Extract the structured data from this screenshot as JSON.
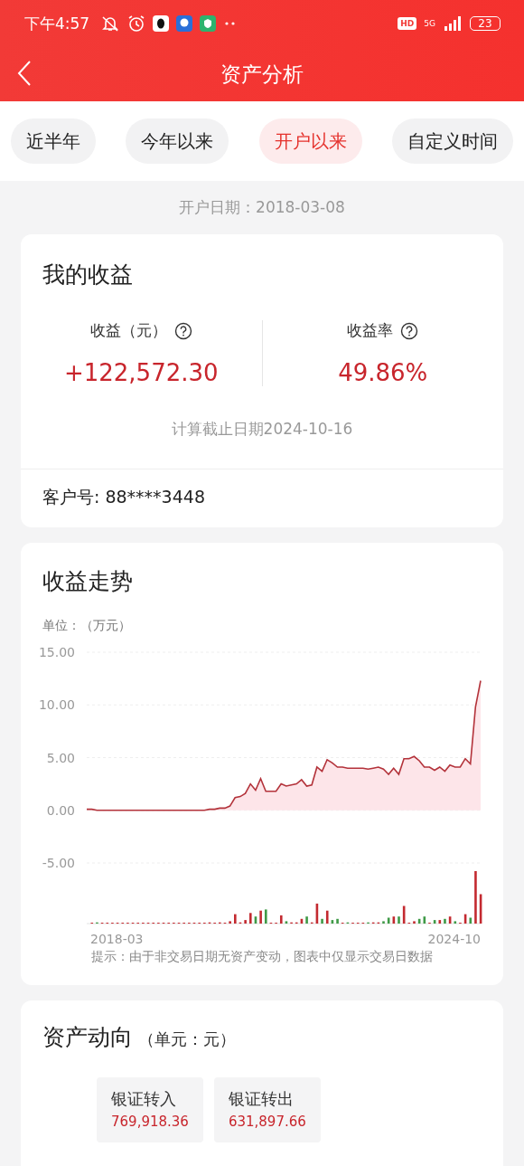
{
  "status_bar": {
    "time": "下午4:57",
    "hd": "HD",
    "network": "5G",
    "battery": "23"
  },
  "header": {
    "title": "资产分析"
  },
  "tabs": [
    {
      "label": "近半年",
      "selected": false
    },
    {
      "label": "今年以来",
      "selected": false
    },
    {
      "label": "开户以来",
      "selected": true
    },
    {
      "label": "自定义时间",
      "selected": false
    }
  ],
  "open_date": "开户日期：2018-03-08",
  "earnings": {
    "title": "我的收益",
    "metrics": [
      {
        "label": "收益（元）",
        "value": "+122,572.30"
      },
      {
        "label": "收益率",
        "value": "49.86%"
      }
    ],
    "as_of": "计算截止日期2024-10-16",
    "customer": "客户号: 88****3448"
  },
  "trend": {
    "title": "收益走势",
    "unit": "单位：（万元）",
    "note": "提示：由于非交易日期无资产变动，图表中仅显示交易日数据",
    "x_axis_labels": [
      "2018-03",
      "2024-10"
    ],
    "chart_data": {
      "type": "area",
      "ylim": [
        -5,
        15
      ],
      "yticks": [
        {
          "value": 15,
          "label": "15.00"
        },
        {
          "value": 10,
          "label": "10.00"
        },
        {
          "value": 5,
          "label": "5.00"
        },
        {
          "value": 0,
          "label": "0.00"
        },
        {
          "value": -5,
          "label": "-5.00"
        }
      ],
      "series": [
        {
          "color": "#b3323a",
          "values": [
            0.1,
            0.1,
            0.0,
            0.0,
            0.0,
            0.0,
            0.0,
            0.0,
            0.0,
            0.0,
            0.0,
            0.0,
            0.0,
            0.0,
            0.0,
            0.0,
            0.0,
            0.0,
            0.0,
            0.0,
            0.0,
            0.0,
            0.0,
            0.0,
            0.1,
            0.1,
            0.2,
            0.2,
            0.4,
            1.2,
            1.3,
            1.6,
            2.5,
            1.9,
            3.0,
            1.8,
            1.8,
            1.8,
            2.5,
            2.3,
            2.4,
            2.5,
            2.9,
            2.3,
            2.4,
            4.1,
            3.7,
            4.8,
            4.5,
            4.1,
            4.1,
            4.0,
            4.0,
            4.0,
            4.0,
            3.9,
            4.0,
            4.1,
            3.9,
            3.4,
            4.0,
            3.4,
            4.9,
            4.9,
            5.1,
            4.7,
            4.1,
            4.1,
            3.8,
            4.1,
            3.7,
            4.3,
            4.1,
            4.1,
            4.9,
            4.4,
            9.8,
            12.3
          ]
        }
      ]
    }
  },
  "flows": {
    "title": "资产动向",
    "unit": "（单元：元）",
    "items": [
      {
        "label": "银证转入",
        "value": "769,918.36"
      },
      {
        "label": "银证转出",
        "value": "631,897.66"
      }
    ]
  }
}
